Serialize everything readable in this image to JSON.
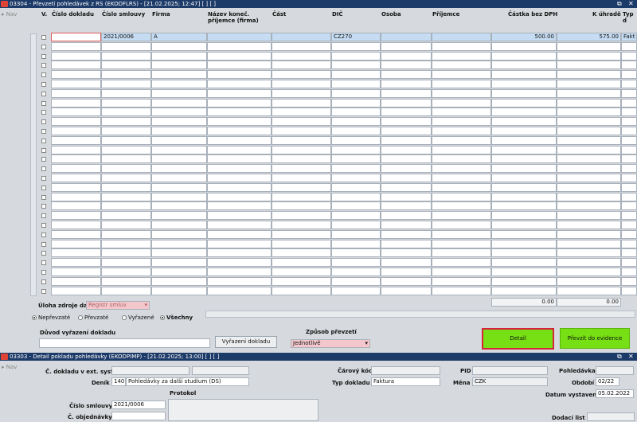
{
  "win1": {
    "title": "03304 - Převzetí pohledávek z RS (EKODFLRS) - [21.02.2025; 12:47]  [ ]  [ ]",
    "nav": "Nav",
    "columns": [
      "V.",
      "Číslo dokladu",
      "Číslo smlouvy",
      "Firma",
      "Název koneč. příjemce (firma)",
      "Část",
      "DIČ",
      "Osoba",
      "Příjemce",
      "Částka bez DPH",
      "K úhradě",
      "Typ d"
    ],
    "row0": {
      "cislo_dokladu": "",
      "cislo_smlouvy": "2021/0006",
      "firma": "A",
      "nazev": "",
      "cast": "",
      "dic": "CZ270",
      "osoba": "",
      "prijemce": "",
      "castka": "500.00",
      "k_uhrade": "575.00",
      "typ": "Fakt"
    },
    "sum_castka": "0.00",
    "sum_k_uhrade": "0.00",
    "uloha_label": "Úloha zdroje dat",
    "uloha_value": "Registr smluv",
    "radios": [
      {
        "label": "Nepřevzaté",
        "on": true
      },
      {
        "label": "Převzaté",
        "on": false
      },
      {
        "label": "Vyřazené",
        "on": false
      },
      {
        "label": "Všechny",
        "on": true
      }
    ],
    "duvod_label": "Důvod vyřazení dokladu",
    "vyrazeni_btn": "Vyřazení dokladu",
    "zpusob_label": "Způsob převzetí",
    "zpusob_value": "Jednotlivě",
    "detail_btn": "Detail",
    "prevzit_btn": "Převzít do evidence"
  },
  "win2": {
    "title": "03303 - Detail pokladu pohledávky (EKODPIMP) - [21.02.2025; 13:00]  [ ]  [ ]",
    "nav": "Nav",
    "c_dokladu_label": "Č. dokladu v ext. syst.",
    "denik_label": "Deník",
    "denik_code": "140",
    "denik_value": "Pohledávky za další studium (DS)",
    "protokol_label": "Protokol",
    "cislo_smlouvy_label": "Číslo smlouvy",
    "cislo_smlouvy_value": "2021/0006",
    "c_objednavky_label": "Č. objednávky",
    "carovy_label": "Čárový kód",
    "typ_dokladu_label": "Typ dokladu",
    "typ_dokladu_value": "Faktura",
    "pid_label": "PID",
    "mena_label": "Měna",
    "mena_value": "CZK",
    "pohledavka_label": "Pohledávka",
    "obdobi_label": "Období",
    "obdobi_value": "02/22",
    "datum_label": "Datum vystavení",
    "datum_value": "05.02.2022",
    "dodaci_label": "Dodací list"
  }
}
